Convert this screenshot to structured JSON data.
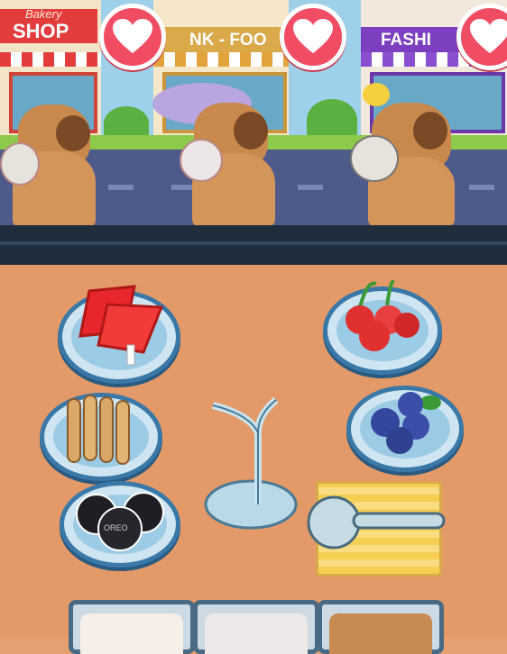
{
  "street": {
    "shop_signs": [
      {
        "small": "Bakery",
        "big": "SHOP"
      },
      {
        "big": "NK - FOO"
      },
      {
        "big": "FASHI"
      }
    ]
  },
  "colors": {
    "sign_red": "#e23c3c",
    "sign_gold": "#d9a94a",
    "sign_purple": "#7b3fbf",
    "heart": "#f04d64",
    "plate_rim": "#3a78a8"
  },
  "customers": [
    {
      "order_icon": "heart-icon",
      "accessory": "none"
    },
    {
      "order_icon": "heart-icon",
      "accessory": "purple-sun-hat"
    },
    {
      "order_icon": "heart-icon",
      "accessory": "yellow-duck"
    }
  ],
  "ingredients": [
    {
      "name": "watermelon-popsicles"
    },
    {
      "name": "cherries"
    },
    {
      "name": "wafer-rolls"
    },
    {
      "name": "blueberries"
    },
    {
      "name": "oreo-cookies",
      "label": "OREO"
    }
  ],
  "tools": [
    {
      "name": "cone-holder-stand"
    },
    {
      "name": "ice-cream-scoop"
    }
  ],
  "trays": [
    {
      "name": "vanilla-sprinkle-tray"
    },
    {
      "name": "cookies-and-cream-tray"
    },
    {
      "name": "caramel-tray"
    }
  ]
}
